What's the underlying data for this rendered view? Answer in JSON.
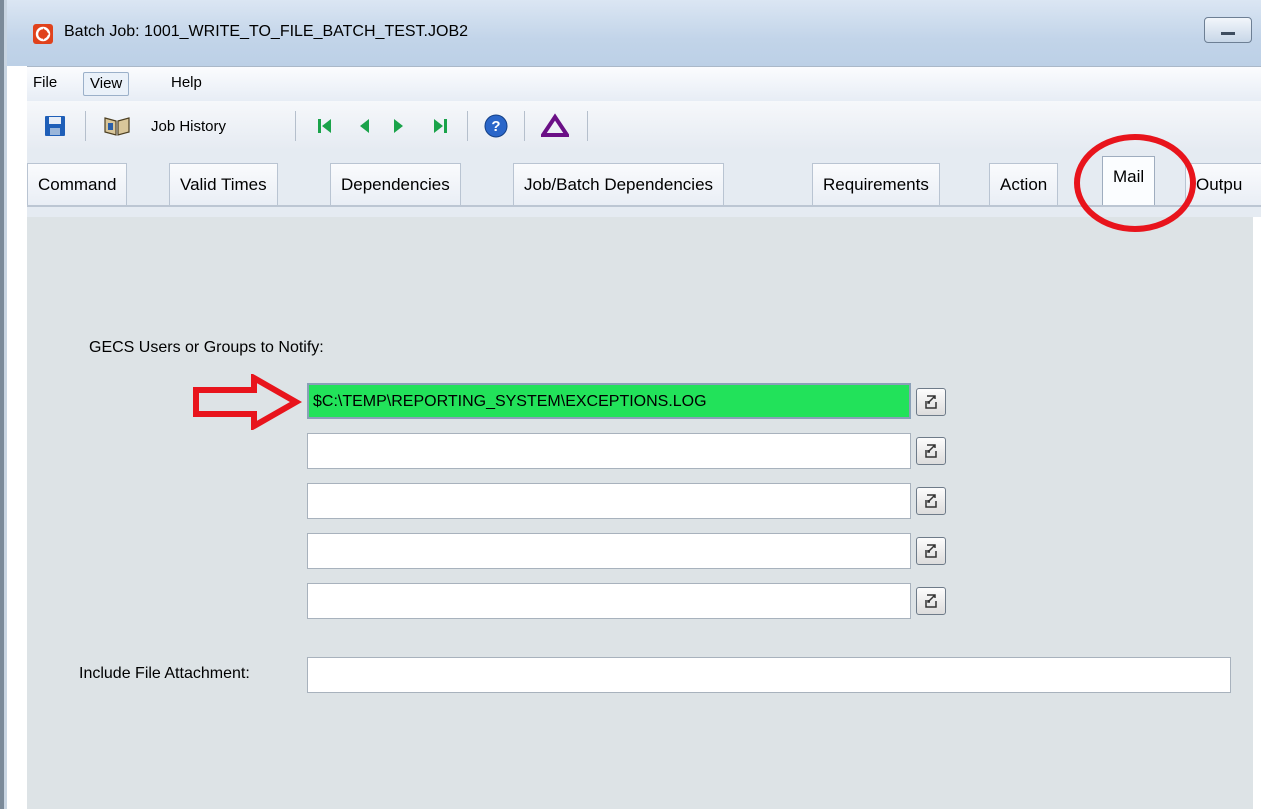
{
  "window": {
    "title": "Batch Job: 1001_WRITE_TO_FILE_BATCH_TEST.JOB2",
    "minimize_icon": "minimize-icon"
  },
  "menu": {
    "items": [
      {
        "label": "File"
      },
      {
        "label": "View"
      },
      {
        "label": "Help"
      }
    ]
  },
  "toolbar": {
    "save_icon": "save-icon",
    "job_history_label": "Job History",
    "nav_icons": [
      "first-icon",
      "previous-icon",
      "next-icon",
      "last-icon"
    ],
    "help_icon": "help-icon",
    "delta_icon": "delta-icon"
  },
  "tabs": [
    {
      "label": "Command"
    },
    {
      "label": "Valid Times"
    },
    {
      "label": "Dependencies"
    },
    {
      "label": "Job/Batch Dependencies"
    },
    {
      "label": "Requirements"
    },
    {
      "label": "Action"
    },
    {
      "label": "Mail",
      "selected": true
    },
    {
      "label": "Outpu"
    }
  ],
  "mail": {
    "notify_label": "GECS Users or Groups to Notify:",
    "notify_fields": [
      {
        "value": "$C:\\TEMP\\REPORTING_SYSTEM\\EXCEPTIONS.LOG"
      },
      {
        "value": ""
      },
      {
        "value": ""
      },
      {
        "value": ""
      },
      {
        "value": ""
      }
    ],
    "attachment_label": "Include File Attachment:",
    "attachment_value": ""
  },
  "colors": {
    "highlight_field": "#22e25a",
    "annotation": "#e8141c",
    "content_bg": "#dde3e6"
  }
}
